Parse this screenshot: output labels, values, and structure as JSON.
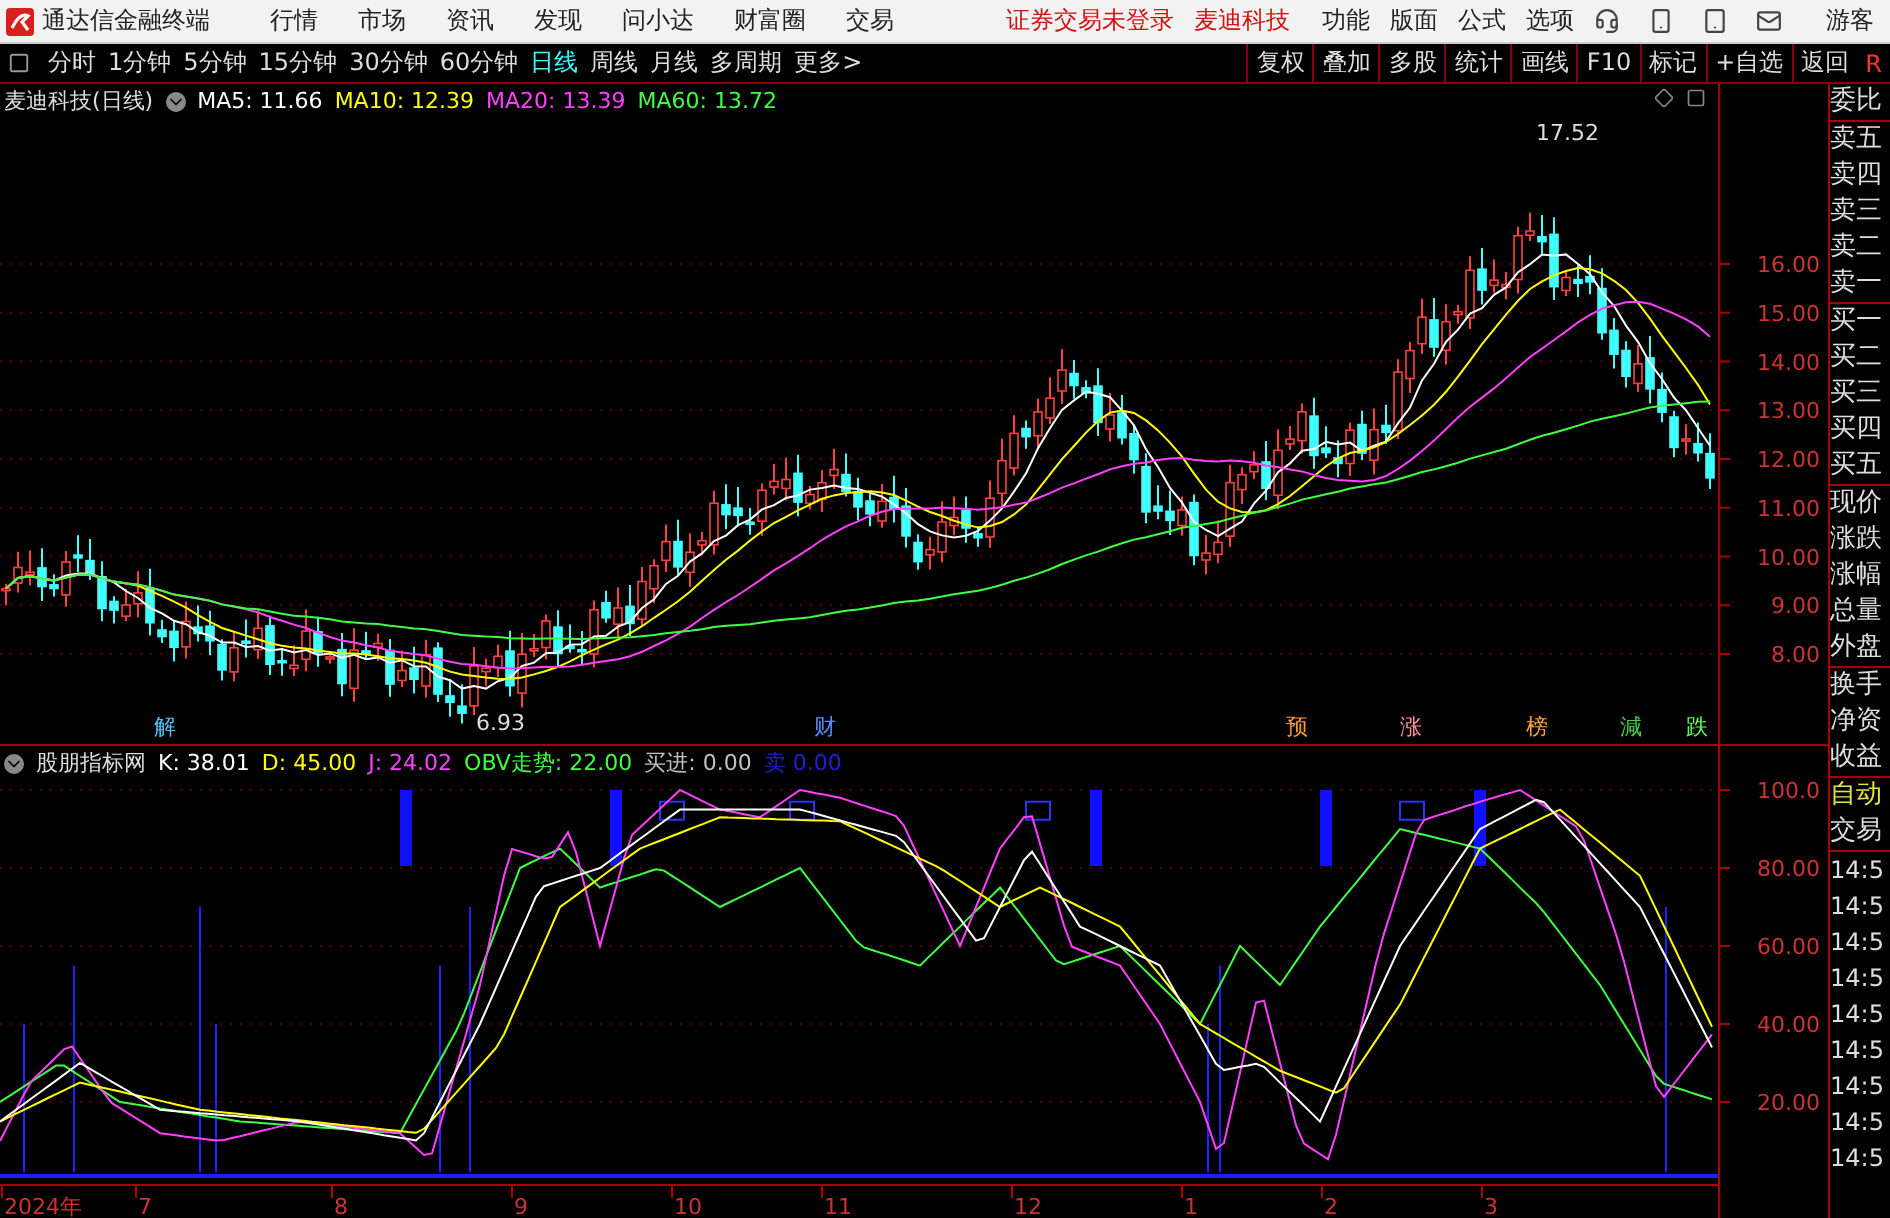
{
  "app": {
    "title": "通达信金融终端",
    "menu": [
      "行情",
      "市场",
      "资讯",
      "发现",
      "问小达",
      "财富圈",
      "交易"
    ],
    "notice": "证券交易未登录",
    "stock": "麦迪科技",
    "tools": [
      "功能",
      "版面",
      "公式",
      "选项"
    ],
    "user": "游客"
  },
  "toolbar": {
    "periods": [
      {
        "label": "分时",
        "selected": false
      },
      {
        "label": "1分钟",
        "selected": false
      },
      {
        "label": "5分钟",
        "selected": false
      },
      {
        "label": "15分钟",
        "selected": false
      },
      {
        "label": "30分钟",
        "selected": false
      },
      {
        "label": "60分钟",
        "selected": false
      },
      {
        "label": "日线",
        "selected": true
      },
      {
        "label": "周线",
        "selected": false
      },
      {
        "label": "月线",
        "selected": false
      },
      {
        "label": "多周期",
        "selected": false
      },
      {
        "label": "更多>",
        "selected": false
      }
    ],
    "actions": [
      "复权",
      "叠加",
      "多股",
      "统计",
      "画线",
      "F10",
      "标记",
      "+自选",
      "返回"
    ],
    "flag": "R"
  },
  "price_chart": {
    "title": "麦迪科技(日线)",
    "indicators": [
      {
        "label": "MA5: 11.66",
        "color": "#ffffff"
      },
      {
        "label": "MA10: 12.39",
        "color": "#ffff00"
      },
      {
        "label": "MA20: 13.39",
        "color": "#ff40ff"
      },
      {
        "label": "MA60: 13.72",
        "color": "#40ff40"
      }
    ],
    "high_label": "17.52",
    "low_label": "6.93",
    "axis": [
      "16.00",
      "15.00",
      "14.00",
      "13.00",
      "12.00",
      "11.00",
      "10.00",
      "9.00",
      "8.00"
    ],
    "events": [
      {
        "label": "解",
        "color": "#4fc3f7"
      },
      {
        "label": "财",
        "color": "#5c8cff"
      },
      {
        "label": "预",
        "color": "#ff9a3c"
      },
      {
        "label": "涨",
        "color": "#ff8fa0"
      },
      {
        "label": "榜",
        "color": "#ffa040"
      },
      {
        "label": "減",
        "color": "#40d040"
      },
      {
        "label": "跌",
        "color": "#60ff60"
      }
    ]
  },
  "indicator_chart": {
    "name": "股朋指标网",
    "values": [
      {
        "label": "K: 38.01",
        "color": "#ffffff"
      },
      {
        "label": "D: 45.00",
        "color": "#ffff00"
      },
      {
        "label": "J: 24.02",
        "color": "#ff40ff"
      },
      {
        "label": "OBV走势: 22.00",
        "color": "#40ff40"
      },
      {
        "label": "买进: 0.00",
        "color": "#c0c0c0"
      },
      {
        "label": "卖 0.00",
        "color": "#2020d0"
      }
    ],
    "axis": [
      "100.0",
      "80.00",
      "60.00",
      "40.00",
      "20.00"
    ]
  },
  "date_axis": [
    "2024年",
    "7",
    "8",
    "9",
    "10",
    "11",
    "12",
    "1",
    "2",
    "3"
  ],
  "quote_panel": {
    "groups": [
      [
        "委比"
      ],
      [
        "卖五",
        "卖四",
        "卖三",
        "卖二",
        "卖一"
      ],
      [
        "买一",
        "买二",
        "买三",
        "买四",
        "买五"
      ],
      [
        "现价",
        "涨跌",
        "涨幅",
        "总量",
        "外盘"
      ],
      [
        "换手",
        "净资",
        "收益"
      ]
    ]
  },
  "trade_panel": {
    "auto": "自动",
    "trade": "交易",
    "times": [
      "14:5",
      "14:5",
      "14:5",
      "14:5",
      "14:5",
      "14:5",
      "14:5",
      "14:5",
      "14:5"
    ]
  }
}
